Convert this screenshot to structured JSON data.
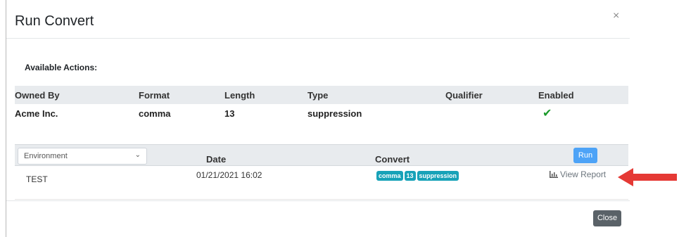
{
  "modal": {
    "title": "Run Convert",
    "close_symbol": "×"
  },
  "available_actions": {
    "title": "Available Actions:",
    "columns": [
      "Owned By",
      "Format",
      "Length",
      "Type",
      "Qualifier",
      "Enabled"
    ],
    "row": {
      "owned_by": "Acme Inc.",
      "format": "comma",
      "length": "13",
      "type": "suppression",
      "qualifier": "",
      "enabled_icon": "check-icon"
    }
  },
  "run_table": {
    "environment_select": {
      "value": "Environment"
    },
    "columns": {
      "date": "Date",
      "convert": "Convert"
    },
    "run_label": "Run",
    "row": {
      "environment": "TEST",
      "date": "01/21/2021 16:02",
      "badges": [
        "comma",
        "13",
        "suppression"
      ],
      "view_report_label": "View Report",
      "view_report_icon": "bar-chart-icon"
    }
  },
  "footer": {
    "close_label": "Close"
  },
  "colors": {
    "badge": "#17a2b8",
    "run_button": "#4da3f7",
    "close_button": "#5a6268",
    "check": "#1a9a2a",
    "arrow": "#e53935"
  }
}
